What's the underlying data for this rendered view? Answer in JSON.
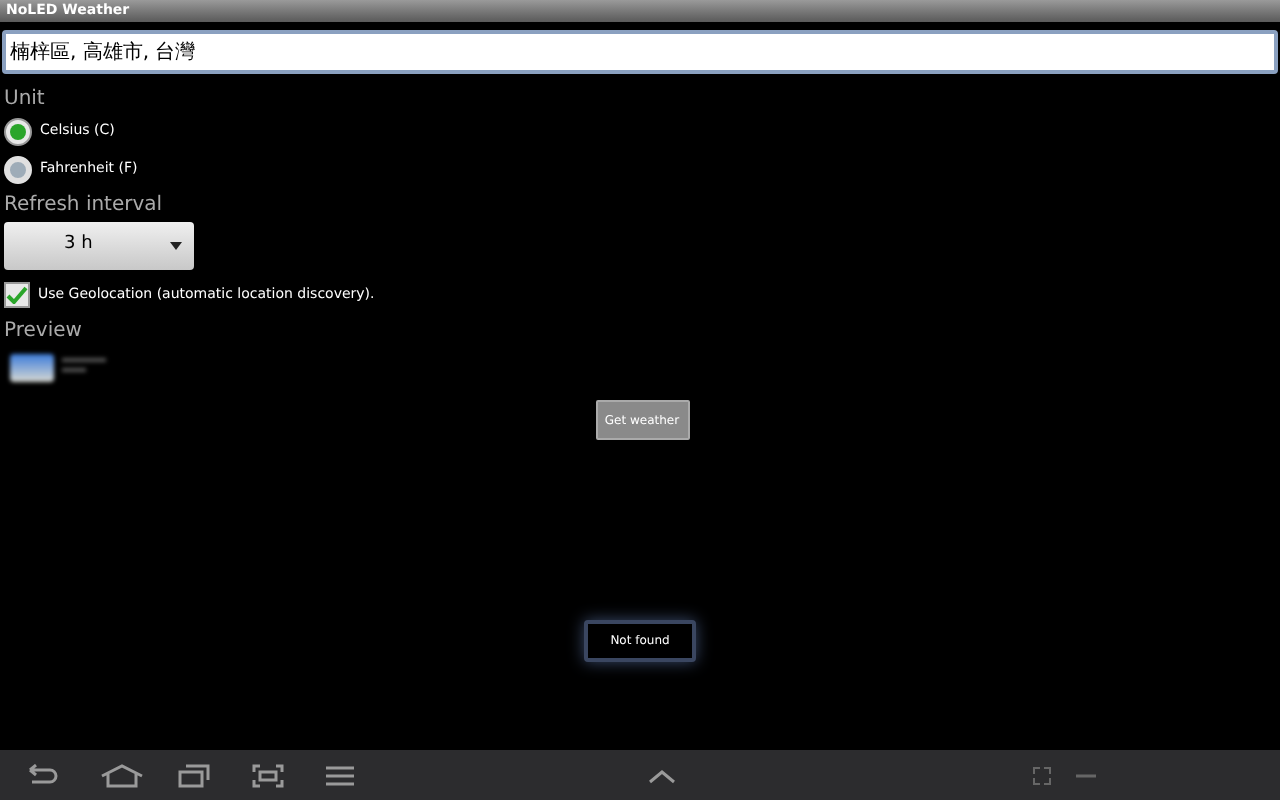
{
  "window": {
    "title": "NoLED Weather"
  },
  "location_field": {
    "value": "楠梓區, 高雄市, 台灣"
  },
  "unit": {
    "label": "Unit",
    "options": [
      {
        "label": "Celsius (C)",
        "selected": true
      },
      {
        "label": "Fahrenheit (F)",
        "selected": false
      }
    ]
  },
  "refresh_interval": {
    "label": "Refresh interval",
    "value": "3 h"
  },
  "geolocation": {
    "label": "Use Geolocation (automatic location discovery).",
    "checked": true
  },
  "preview": {
    "label": "Preview"
  },
  "get_weather_button": "Get weather",
  "toast": "Not found"
}
